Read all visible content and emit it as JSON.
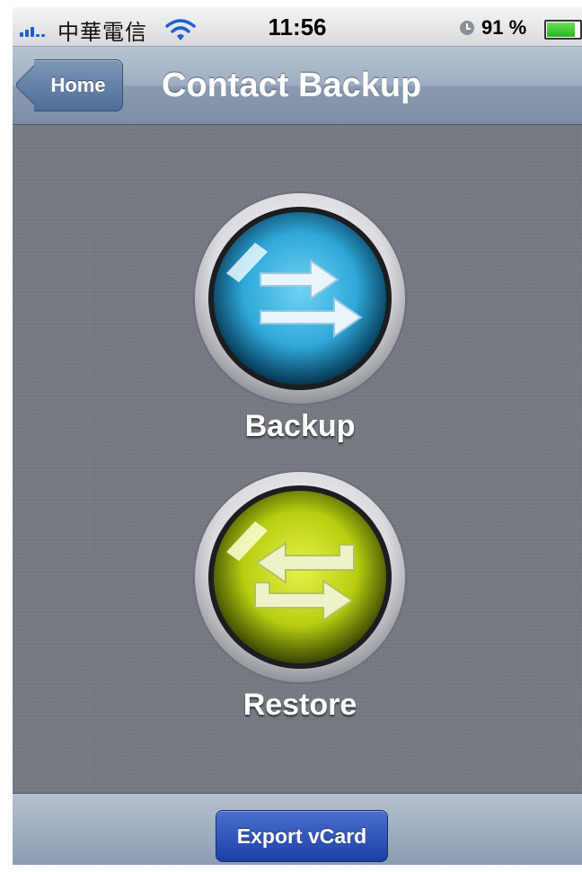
{
  "status_bar": {
    "carrier": "中華電信",
    "time": "11:56",
    "battery_percent": "91 %",
    "battery_level": 0.91
  },
  "nav_bar": {
    "back_label": "Home",
    "title": "Contact Backup"
  },
  "actions": {
    "backup_label": "Backup",
    "restore_label": "Restore"
  },
  "toolbar": {
    "export_label": "Export vCard"
  },
  "icons": {
    "backup": "double-right-arrows-icon",
    "restore": "swap-arrows-icon"
  },
  "colors": {
    "backup_orb": "#2fa8d8",
    "restore_orb": "#b7cf10",
    "nav_bar": "#8a9bb0",
    "export_button": "#2a4fbf"
  }
}
